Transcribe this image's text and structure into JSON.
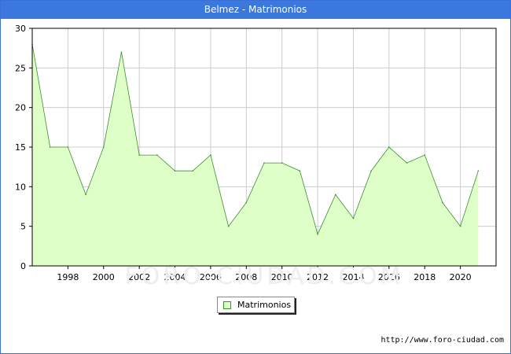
{
  "title": "Belmez - Matrimonios",
  "watermark": "FORO-CIUDAD.COM",
  "footer_url": "http://www.foro-ciudad.com",
  "colors": {
    "header": "#3a78de",
    "fill": "#dfffc8",
    "line": "#3a8f2e",
    "grid": "#cccccc"
  },
  "legend": {
    "label": "Matrimonios"
  },
  "chart_data": {
    "type": "area",
    "title": "Belmez - Matrimonios",
    "xlabel": "",
    "ylabel": "",
    "x": [
      1996,
      1997,
      1998,
      1999,
      2000,
      2001,
      2002,
      2003,
      2004,
      2005,
      2006,
      2007,
      2008,
      2009,
      2010,
      2011,
      2012,
      2013,
      2014,
      2015,
      2016,
      2017,
      2018,
      2019,
      2020,
      2021
    ],
    "series": [
      {
        "name": "Matrimonios",
        "values": [
          28,
          15,
          15,
          9,
          15,
          27,
          14,
          14,
          12,
          12,
          14,
          5,
          8,
          13,
          13,
          12,
          4,
          9,
          6,
          12,
          15,
          13,
          14,
          8,
          5,
          12
        ]
      }
    ],
    "xlim": [
      1996,
      2022
    ],
    "ylim": [
      0,
      30
    ],
    "yticks": [
      0,
      5,
      10,
      15,
      20,
      25,
      30
    ],
    "xticks": [
      1998,
      2000,
      2002,
      2004,
      2006,
      2008,
      2010,
      2012,
      2014,
      2016,
      2018,
      2020
    ],
    "grid": true,
    "legend_position": "bottom-center"
  }
}
